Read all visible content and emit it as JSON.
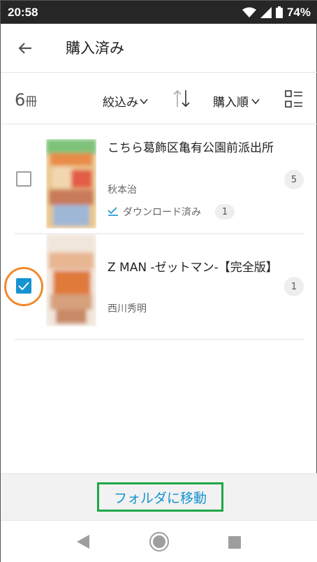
{
  "status_bar": {
    "time": "20:58",
    "battery": "74%"
  },
  "app_bar": {
    "title": "購入済み"
  },
  "toolbar": {
    "count": "6",
    "count_unit": "冊",
    "filter_label": "絞込み",
    "order_label": "購入順"
  },
  "items": [
    {
      "title": "こちら葛飾区亀有公園前派出所",
      "author": "秋本治",
      "download_status": "ダウンロード済み",
      "downloaded_count": "1",
      "volume_count": "5",
      "checked": false
    },
    {
      "title": "Z MAN -ゼットマン-【完全版】",
      "author": "西川秀明",
      "volume_count": "1",
      "checked": true
    }
  ],
  "bottom_action": {
    "move_label": "フォルダに移動"
  },
  "colors": {
    "accent": "#1593d0",
    "highlight_orange": "#f08a2d",
    "highlight_green": "#1fa746"
  }
}
